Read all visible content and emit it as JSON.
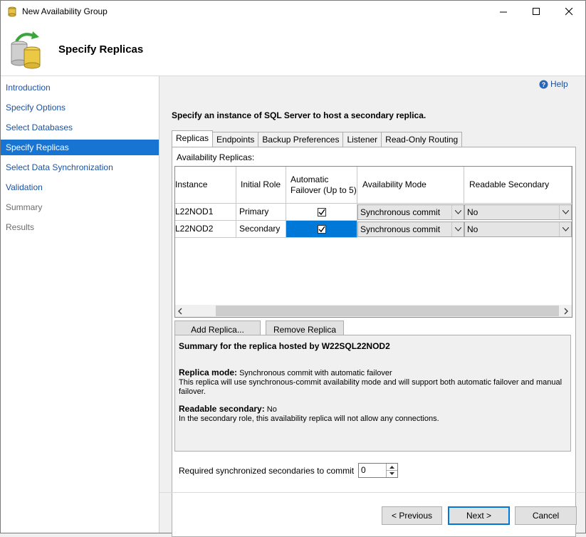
{
  "window": {
    "title": "New Availability Group",
    "minimize_icon": "minimize-icon",
    "maximize_icon": "maximize-icon",
    "close_icon": "close-icon"
  },
  "header": {
    "title": "Specify Replicas",
    "icon": "database-sync-icon"
  },
  "sidebar": {
    "items": [
      {
        "label": "Introduction",
        "state": "link"
      },
      {
        "label": "Specify Options",
        "state": "link"
      },
      {
        "label": "Select Databases",
        "state": "link"
      },
      {
        "label": "Specify Replicas",
        "state": "active"
      },
      {
        "label": "Select Data Synchronization",
        "state": "link"
      },
      {
        "label": "Validation",
        "state": "link"
      },
      {
        "label": "Summary",
        "state": "disabled"
      },
      {
        "label": "Results",
        "state": "disabled"
      }
    ]
  },
  "help": {
    "label": "Help",
    "icon": "help-icon"
  },
  "main": {
    "heading": "Specify an instance of SQL Server to host a secondary replica.",
    "tabs": [
      {
        "label": "Replicas",
        "active": true
      },
      {
        "label": "Endpoints",
        "active": false
      },
      {
        "label": "Backup Preferences",
        "active": false
      },
      {
        "label": "Listener",
        "active": false
      },
      {
        "label": "Read-Only Routing",
        "active": false
      }
    ],
    "grid_label": "Availability Replicas:",
    "columns": [
      "Instance",
      "Initial Role",
      "Automatic Failover (Up to 5)",
      "Availability Mode",
      "Readable Secondary"
    ],
    "rows": [
      {
        "instance": "L22NOD1",
        "role": "Primary",
        "failover": true,
        "mode": "Synchronous commit",
        "readable": "No"
      },
      {
        "instance": "L22NOD2",
        "role": "Secondary",
        "failover": true,
        "mode": "Synchronous commit",
        "readable": "No"
      }
    ],
    "add_replica": "Add Replica...",
    "remove_replica": "Remove Replica",
    "summary": {
      "title": "Summary for the replica hosted by W22SQL22NOD2",
      "mode_label": "Replica mode:",
      "mode_value": "Synchronous commit with automatic failover",
      "mode_desc": "This replica will use synchronous-commit availability mode and will support both automatic failover and manual failover.",
      "readable_label": "Readable secondary:",
      "readable_value": "No",
      "readable_desc": "In the secondary role, this availability replica will not allow any connections."
    },
    "required_label": "Required synchronized secondaries to commit",
    "required_value": "0"
  },
  "footer": {
    "previous": "< Previous",
    "next": "Next >",
    "cancel": "Cancel"
  },
  "colors": {
    "accent": "#1874d2",
    "link": "#1a52a5",
    "selection": "#0078d7"
  }
}
